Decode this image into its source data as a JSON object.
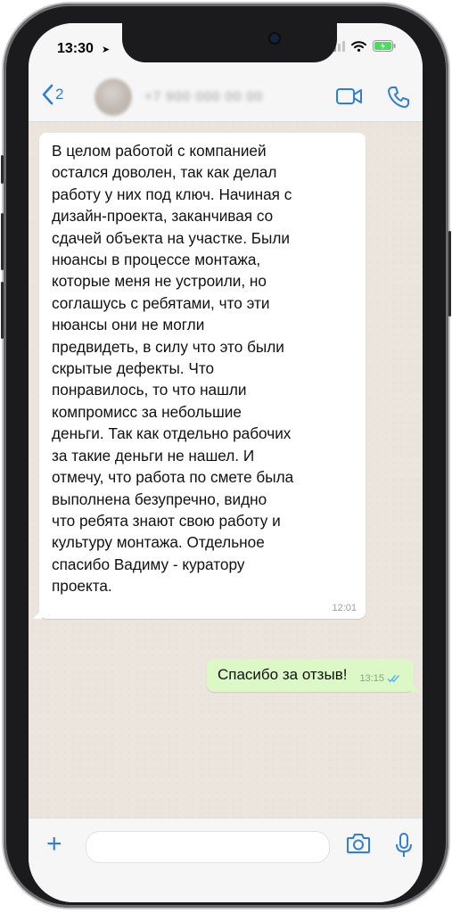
{
  "status": {
    "time": "13:30",
    "location_glyph": "➤"
  },
  "nav": {
    "back_label": "‹",
    "back_count": "2",
    "contact_name": "+7 900 000 00 00"
  },
  "messages": {
    "incoming": {
      "text": "В целом работой с компанией\nостался доволен, так как делал\nработу у них под ключ. Начиная с\nдизайн-проекта, заканчивая со\nсдачей объекта на участке. Были\nнюансы в процессе монтажа,\nкоторые меня не устроили, но\nсоглашусь с ребятами, что эти\nнюансы они не могли\nпредвидеть, в силу что это были\nскрытые дефекты. Что\nпонравилось, то что нашли\nкомпромисс за небольшие\nденьги. Так как отдельно рабочих\nза такие деньги не нашел. И\nотмечу, что работа по смете была\nвыполнена безупречно, видно\nчто ребята знают свою работу и\nкультуру монтажа. Отдельное\nспасибо Вадиму - куратору\nпроекта.",
      "time": "12:01"
    },
    "outgoing": {
      "text": "Спасибо за отзыв!",
      "time": "13:15"
    }
  },
  "composer": {
    "placeholder": ""
  },
  "colors": {
    "accent": "#2f7fd6",
    "outgoing_bubble": "#dcf8c6",
    "incoming_bubble": "#ffffff",
    "chat_background": "#ece5dd",
    "battery_charging": "#4cd964"
  },
  "icons": [
    "location-arrow-icon",
    "signal-icon",
    "wifi-icon",
    "battery-icon",
    "back-chevron-icon",
    "video-call-icon",
    "phone-call-icon",
    "plus-icon",
    "camera-icon",
    "microphone-icon",
    "double-check-icon"
  ]
}
